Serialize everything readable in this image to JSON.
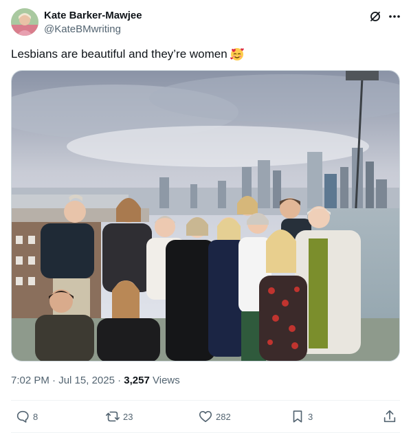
{
  "author": {
    "display_name": "Kate Barker-Mawjee",
    "handle": "@KateBMwriting"
  },
  "header_icons": {
    "grok": "grok-icon",
    "more": "more-icon"
  },
  "tweet": {
    "text": "Lesbians are beautiful and they’re women",
    "emoji": "smiling-face-with-hearts"
  },
  "meta": {
    "time": "7:02 PM",
    "separator": "·",
    "date": "Jul 15, 2025",
    "views_count": "3,257",
    "views_label": "Views"
  },
  "actions": {
    "replies": "8",
    "reposts": "23",
    "likes": "282",
    "bookmarks": "3"
  },
  "colors": {
    "text": "#0f1419",
    "secondary": "#536471",
    "border": "#cfd9de",
    "divider": "#eff3f4"
  }
}
